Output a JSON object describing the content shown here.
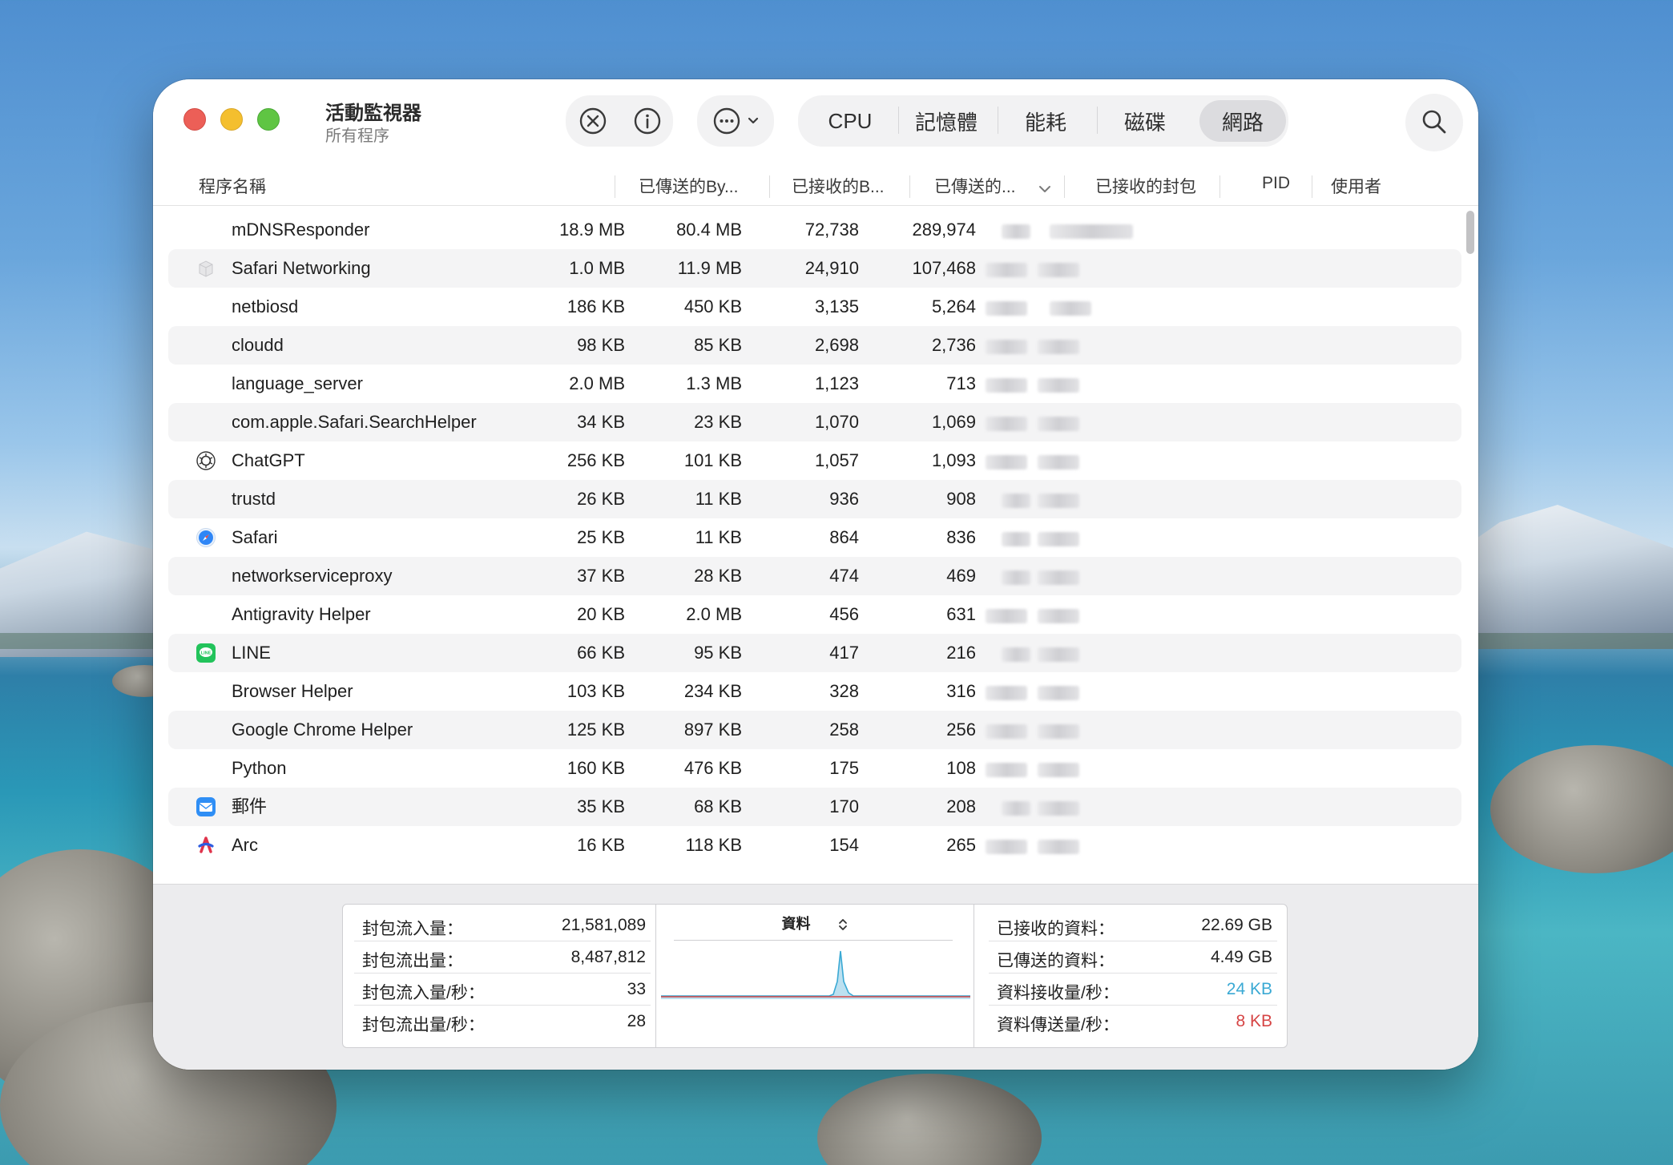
{
  "window": {
    "title": "活動監視器",
    "subtitle": "所有程序"
  },
  "icons": {
    "stop": "stop-process-icon",
    "info": "info-icon",
    "more": "more-options-icon",
    "search": "search-icon"
  },
  "tabs": [
    {
      "label": "CPU",
      "selected": false
    },
    {
      "label": "記憶體",
      "selected": false
    },
    {
      "label": "能耗",
      "selected": false
    },
    {
      "label": "磁碟",
      "selected": false
    },
    {
      "label": "網路",
      "selected": true
    }
  ],
  "columns": {
    "name": "程序名稱",
    "sent_bytes": "已傳送的By...",
    "recv_bytes": "已接收的B...",
    "sent_packets": "已傳送的...",
    "recv_packets": "已接收的封包",
    "pid": "PID",
    "user": "使用者"
  },
  "rows": [
    {
      "name": "mDNSResponder",
      "sent": "18.9 MB",
      "recv": "80.4 MB",
      "spk": "72,738",
      "rpk": "289,974",
      "icon": ""
    },
    {
      "name": "Safari Networking",
      "sent": "1.0 MB",
      "recv": "11.9 MB",
      "spk": "24,910",
      "rpk": "107,468",
      "icon": "generic-app-icon"
    },
    {
      "name": "netbiosd",
      "sent": "186 KB",
      "recv": "450 KB",
      "spk": "3,135",
      "rpk": "5,264",
      "icon": ""
    },
    {
      "name": "cloudd",
      "sent": "98 KB",
      "recv": "85 KB",
      "spk": "2,698",
      "rpk": "2,736",
      "icon": ""
    },
    {
      "name": "language_server",
      "sent": "2.0 MB",
      "recv": "1.3 MB",
      "spk": "1,123",
      "rpk": "713",
      "icon": ""
    },
    {
      "name": "com.apple.Safari.SearchHelper",
      "sent": "34 KB",
      "recv": "23 KB",
      "spk": "1,070",
      "rpk": "1,069",
      "icon": ""
    },
    {
      "name": "ChatGPT",
      "sent": "256 KB",
      "recv": "101 KB",
      "spk": "1,057",
      "rpk": "1,093",
      "icon": "chatgpt-icon"
    },
    {
      "name": "trustd",
      "sent": "26 KB",
      "recv": "11 KB",
      "spk": "936",
      "rpk": "908",
      "icon": ""
    },
    {
      "name": "Safari",
      "sent": "25 KB",
      "recv": "11 KB",
      "spk": "864",
      "rpk": "836",
      "icon": "safari-icon"
    },
    {
      "name": "networkserviceproxy",
      "sent": "37 KB",
      "recv": "28 KB",
      "spk": "474",
      "rpk": "469",
      "icon": ""
    },
    {
      "name": "Antigravity Helper",
      "sent": "20 KB",
      "recv": "2.0 MB",
      "spk": "456",
      "rpk": "631",
      "icon": ""
    },
    {
      "name": "LINE",
      "sent": "66 KB",
      "recv": "95 KB",
      "spk": "417",
      "rpk": "216",
      "icon": "line-icon"
    },
    {
      "name": "Browser Helper",
      "sent": "103 KB",
      "recv": "234 KB",
      "spk": "328",
      "rpk": "316",
      "icon": ""
    },
    {
      "name": "Google Chrome Helper",
      "sent": "125 KB",
      "recv": "897 KB",
      "spk": "258",
      "rpk": "256",
      "icon": ""
    },
    {
      "name": "Python",
      "sent": "160 KB",
      "recv": "476 KB",
      "spk": "175",
      "rpk": "108",
      "icon": ""
    },
    {
      "name": "郵件",
      "sent": "35 KB",
      "recv": "68 KB",
      "spk": "170",
      "rpk": "208",
      "icon": "mail-icon"
    },
    {
      "name": "Arc",
      "sent": "16 KB",
      "recv": "118 KB",
      "spk": "154",
      "rpk": "265",
      "icon": "arc-icon"
    }
  ],
  "footer": {
    "left": [
      {
        "label": "封包流入量：",
        "value": "21,581,089"
      },
      {
        "label": "封包流出量：",
        "value": "8,487,812"
      },
      {
        "label": "封包流入量/秒：",
        "value": "33"
      },
      {
        "label": "封包流出量/秒：",
        "value": "28"
      }
    ],
    "graph_selector": "資料",
    "right": [
      {
        "label": "已接收的資料：",
        "value": "22.69 GB",
        "color": "#222222"
      },
      {
        "label": "已傳送的資料：",
        "value": "4.49 GB",
        "color": "#222222"
      },
      {
        "label": "資料接收量/秒：",
        "value": "24 KB",
        "color": "#3aa9d4"
      },
      {
        "label": "資料傳送量/秒：",
        "value": "8 KB",
        "color": "#d64545"
      }
    ]
  },
  "colors": {
    "received": "#3aa9d4",
    "sent": "#d64545",
    "selected_tab": "#dcdcdf"
  }
}
